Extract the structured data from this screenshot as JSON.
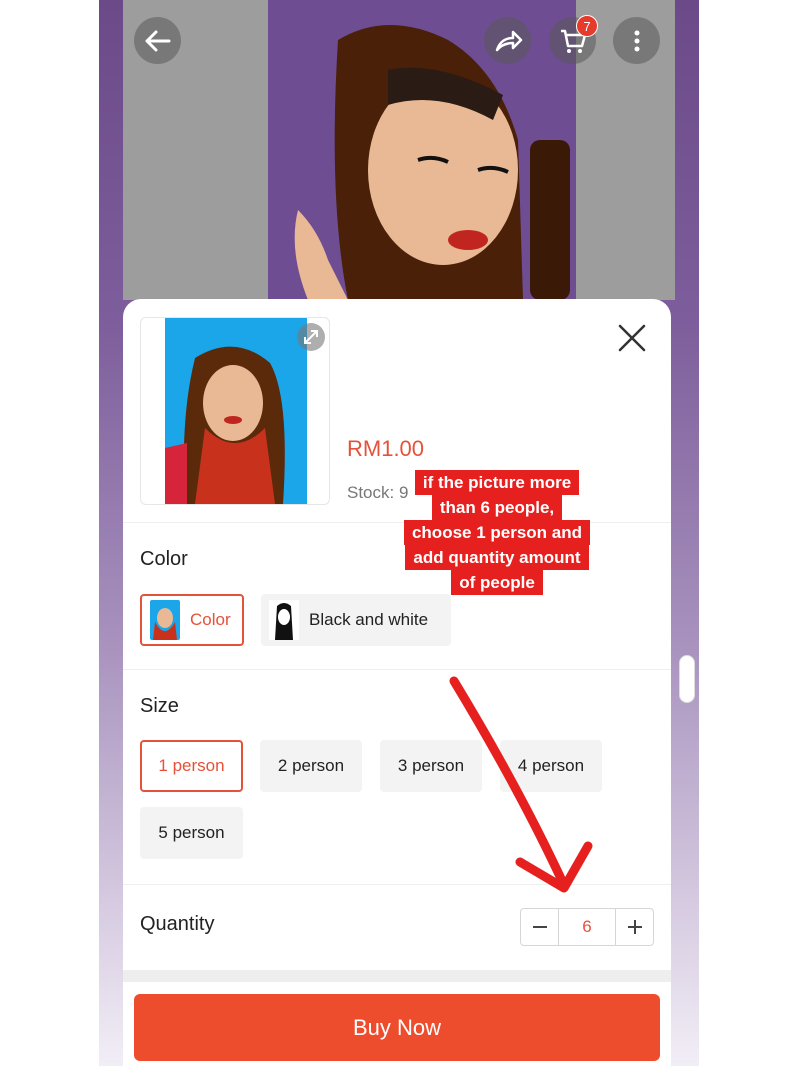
{
  "header": {
    "back_icon": "arrow-left-icon",
    "share_icon": "share-icon",
    "cart_icon": "cart-icon",
    "cart_count": "7",
    "more_icon": "more-vertical-icon"
  },
  "product": {
    "price": "RM1.00",
    "stock_label": "Stock: 9",
    "expand_icon": "expand-icon",
    "close_icon": "close-icon"
  },
  "color": {
    "title": "Color",
    "options": [
      {
        "label": "Color",
        "selected": true
      },
      {
        "label": "Black and white",
        "selected": false
      }
    ]
  },
  "size": {
    "title": "Size",
    "options": [
      {
        "label": "1 person",
        "selected": true
      },
      {
        "label": "2 person",
        "selected": false
      },
      {
        "label": "3 person",
        "selected": false
      },
      {
        "label": "4 person",
        "selected": false
      },
      {
        "label": "5 person",
        "selected": false
      }
    ]
  },
  "quantity": {
    "title": "Quantity",
    "minus": "−",
    "value": "6",
    "plus": "+"
  },
  "buy_label": "Buy Now",
  "annotation": {
    "lines": [
      "if the picture more",
      "than 6 people,",
      "choose 1 person and",
      "add quantity amount",
      "of people"
    ]
  },
  "colors": {
    "accent": "#ee4d2d",
    "price": "#e5523a",
    "note_bg": "#e6201f"
  }
}
